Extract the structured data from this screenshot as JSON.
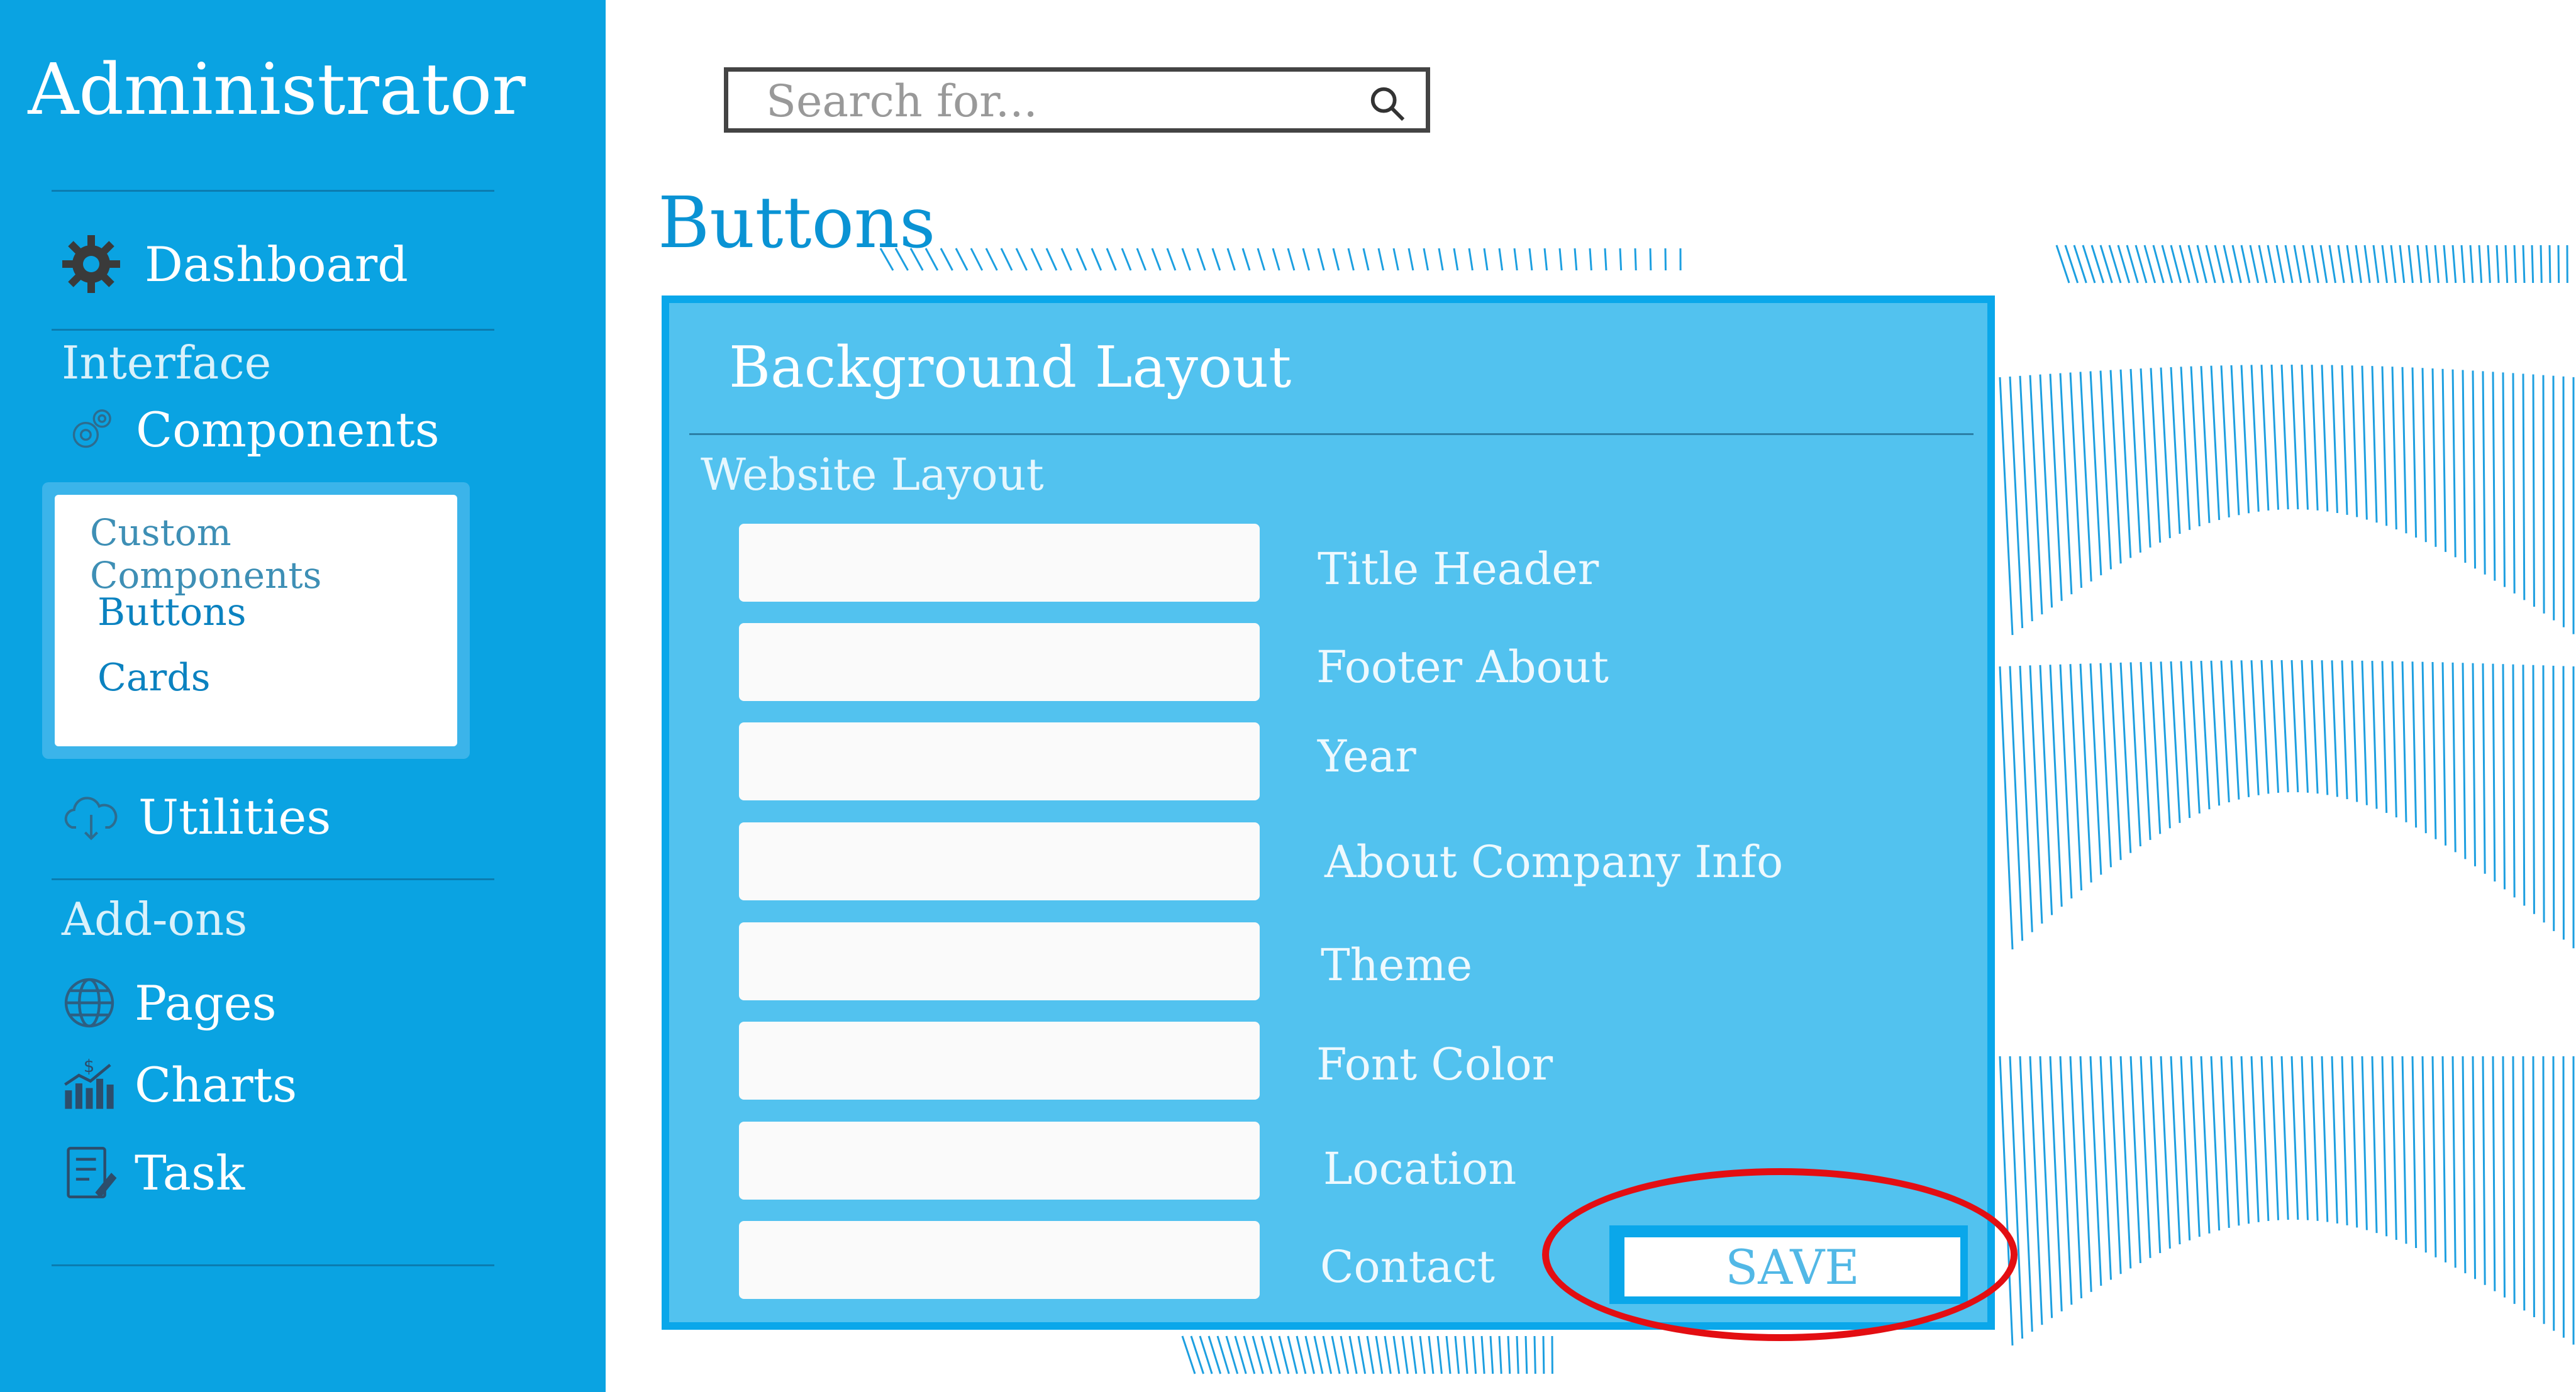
{
  "sidebar": {
    "brand": "Administrator",
    "dashboard_label": "Dashboard",
    "interface_heading": "Interface",
    "components_label": "Components",
    "submenu": {
      "title": "Custom Components",
      "items": [
        {
          "label": "Buttons"
        },
        {
          "label": "Cards"
        }
      ]
    },
    "utilities_label": "Utilities",
    "addons_heading": "Add-ons",
    "pages_label": "Pages",
    "charts_label": "Charts",
    "task_label": "Task"
  },
  "search": {
    "placeholder": "Search for...",
    "icon": "search-icon"
  },
  "page": {
    "title": "Buttons"
  },
  "panel": {
    "title": "Background Layout",
    "subtitle": "Website Layout",
    "fields": [
      {
        "label": "Title Header",
        "value": ""
      },
      {
        "label": "Footer About",
        "value": ""
      },
      {
        "label": "Year",
        "value": ""
      },
      {
        "label": "About Company Info",
        "value": ""
      },
      {
        "label": "Theme",
        "value": ""
      },
      {
        "label": "Font Color",
        "value": ""
      },
      {
        "label": "Location",
        "value": ""
      },
      {
        "label": "Contact",
        "value": ""
      }
    ],
    "save_label": "SAVE"
  },
  "colors": {
    "sidebar": "#0aa3e2",
    "panel": "#52c2ef",
    "accent": "#0aa7ea",
    "highlight": "#e30e12"
  }
}
